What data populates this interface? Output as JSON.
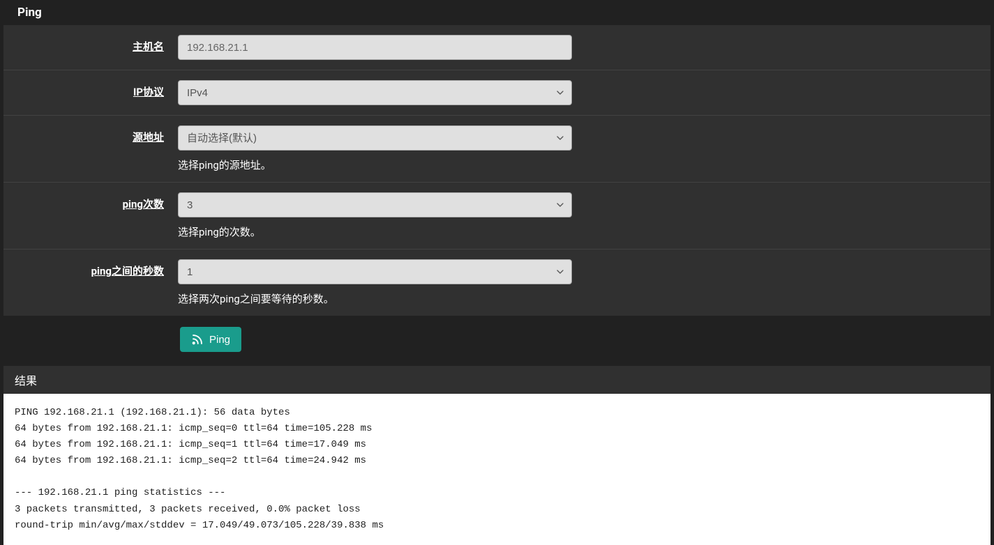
{
  "panel": {
    "title": "Ping"
  },
  "form": {
    "hostname": {
      "label": "主机名",
      "value": "192.168.21.1"
    },
    "ip_protocol": {
      "label": "IP协议",
      "value": "IPv4"
    },
    "source_address": {
      "label": "源地址",
      "value": "自动选择(默认)",
      "help": "选择ping的源地址。"
    },
    "count": {
      "label": "ping次数",
      "value": "3",
      "help": "选择ping的次数。"
    },
    "interval": {
      "label": "ping之间的秒数",
      "value": "1",
      "help": "选择两次ping之间要等待的秒数。"
    }
  },
  "button": {
    "ping_label": "Ping"
  },
  "results": {
    "title": "结果",
    "output": "PING 192.168.21.1 (192.168.21.1): 56 data bytes\n64 bytes from 192.168.21.1: icmp_seq=0 ttl=64 time=105.228 ms\n64 bytes from 192.168.21.1: icmp_seq=1 ttl=64 time=17.049 ms\n64 bytes from 192.168.21.1: icmp_seq=2 ttl=64 time=24.942 ms\n\n--- 192.168.21.1 ping statistics ---\n3 packets transmitted, 3 packets received, 0.0% packet loss\nround-trip min/avg/max/stddev = 17.049/49.073/105.228/39.838 ms"
  }
}
